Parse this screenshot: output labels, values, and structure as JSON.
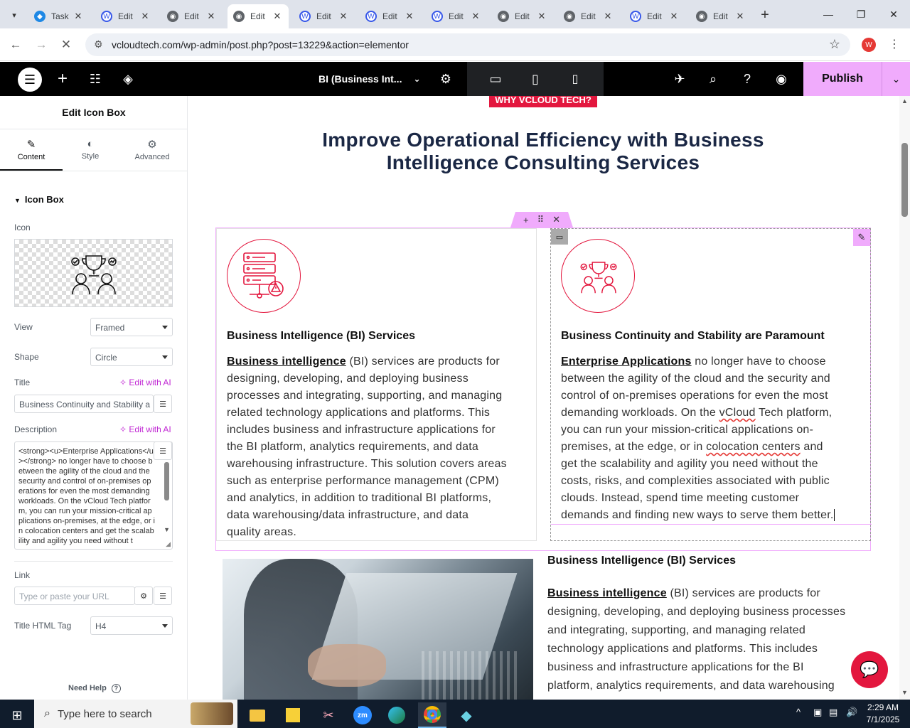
{
  "browser": {
    "tabs": [
      {
        "label": "Task",
        "active": false
      },
      {
        "label": "Edit",
        "active": false
      },
      {
        "label": "Edit",
        "active": false
      },
      {
        "label": "Edit",
        "active": true
      },
      {
        "label": "Edit",
        "active": false
      },
      {
        "label": "Edit",
        "active": false
      },
      {
        "label": "Edit",
        "active": false
      },
      {
        "label": "Edit",
        "active": false
      },
      {
        "label": "Edit",
        "active": false
      },
      {
        "label": "Edit",
        "active": false
      },
      {
        "label": "Edit",
        "active": false
      }
    ],
    "url": "vcloudtech.com/wp-admin/post.php?post=13229&action=elementor",
    "profile_initial": "W"
  },
  "editor": {
    "document_title": "BI  (Business Int...",
    "publish_label": "Publish"
  },
  "panel": {
    "title": "Edit Icon Box",
    "tabs": [
      "Content",
      "Style",
      "Advanced"
    ],
    "section_title": "Icon Box",
    "icon_label": "Icon",
    "view_label": "View",
    "view_value": "Framed",
    "shape_label": "Shape",
    "shape_value": "Circle",
    "title_label": "Title",
    "edit_ai_label": "Edit with AI",
    "title_value": "Business Continuity and Stability a",
    "description_label": "Description",
    "description_value": "<strong><u>Enterprise Applications</u></strong> no longer have to choose between the agility of the cloud and the security and control of on-premises operations for even the most demanding workloads. On the vCloud Tech platform, you can run your mission-critical applications on-premises, at the edge, or in colocation centers and get the scalability and agility you need without t",
    "link_label": "Link",
    "link_placeholder": "Type or paste your URL",
    "tag_label": "Title HTML Tag",
    "tag_value": "H4",
    "help_label": "Need Help"
  },
  "canvas": {
    "badge": "WHY VCLOUD TECH?",
    "heading_line1": "Improve Operational Efficiency with Business",
    "heading_line2": "Intelligence Consulting Services",
    "box1": {
      "title": "Business Intelligence (BI) Services",
      "lead": "Business intelligence",
      "lines": [
        " (BI) services are products for",
        "designing, developing, and deploying business",
        "processes and integrating, supporting, and managing",
        "related technology applications and platforms. This",
        "includes business and infrastructure applications for",
        "the BI platform, analytics requirements, and data",
        "warehousing infrastructure. This solution covers areas",
        "such as enterprise performance management (CPM)",
        "and analytics, in addition to traditional BI platforms,",
        "data warehousing/data infrastructure, and data",
        "quality areas."
      ]
    },
    "box2": {
      "title": "Business Continuity and Stability are Paramount",
      "lead": "Enterprise Applications",
      "l1": " no longer have to choose",
      "l2": "between the agility of the cloud and the security and",
      "l3": "control of on-premises operations for even the most",
      "l4a": "demanding workloads. On the ",
      "l4b": "vCloud",
      "l4c": " Tech platform,",
      "l5": "you can run your mission-critical applications on-",
      "l6a": "premises, at the edge, or in ",
      "l6b": "colocation centers",
      "l6c": " and",
      "l7": "get the scalability and agility you need without the",
      "l8": "costs, risks, and complexities associated with public",
      "l9": "clouds. Instead, spend time meeting customer",
      "l10": "demands and finding new ways to serve them better."
    },
    "box3": {
      "title": "Business Intelligence (BI) Services",
      "lead": "Business intelligence",
      "lines": [
        " (BI) services are products for",
        "designing, developing, and deploying business processes",
        "and integrating, supporting, and managing related",
        "technology applications and platforms. This includes",
        "business and infrastructure applications for the BI",
        "platform, analytics requirements, and data warehousing"
      ]
    }
  },
  "taskbar": {
    "search_placeholder": "Type here to search",
    "time": "2:29 AM",
    "date": "7/1/2025"
  }
}
